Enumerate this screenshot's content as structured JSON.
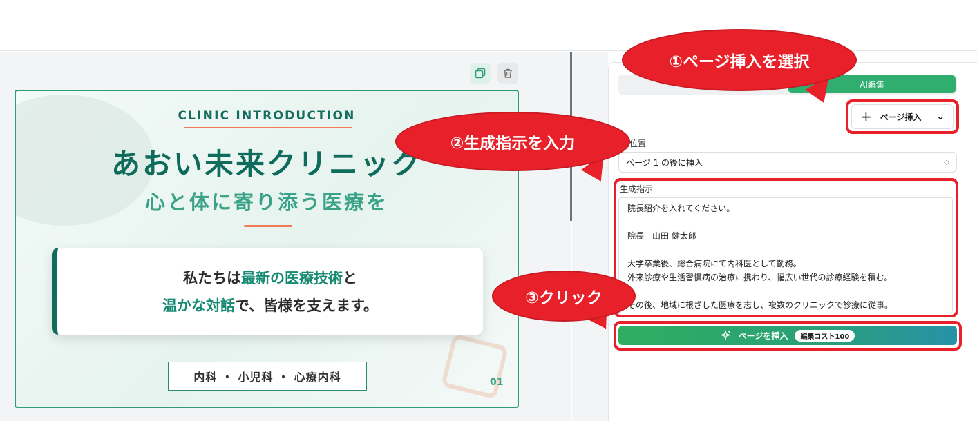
{
  "slide": {
    "kicker": "CLINIC INTRODUCTION",
    "title": "あおい未来クリニック",
    "subtitle": "心と体に寄り添う医療を",
    "message_line1": [
      {
        "text": "私たちは",
        "highlight": false
      },
      {
        "text": "最新の医療技術",
        "highlight": true
      },
      {
        "text": "と",
        "highlight": false
      }
    ],
    "message_line2": [
      {
        "text": "温かな対話",
        "highlight": true
      },
      {
        "text": "で、皆様を支えます。",
        "highlight": false
      }
    ],
    "departments": "内科 ・ 小児科 ・ 心療内科",
    "page_number": "01"
  },
  "panel": {
    "tab_ai_label": "AI編集",
    "insert_button_label": "ページ挿入",
    "position_label": "入位置",
    "position_value": "ページ 1 の後に挿入",
    "instruction_label": "生成指示",
    "instruction_text": "院長紹介を入れてください。\n\n院長　山田 健太郎\n\n大学卒業後、総合病院にて内科医として勤務。\n外来診療や生活習慣病の治療に携わり、幅広い世代の診療経験を積む。\n\nその後、地域に根ざした医療を志し、複数のクリニックで診療に従事。\n患者様一人ひとりに寄り添った、丁寧でわかりやすい診療を大切にしている。",
    "generate_button_label": "ページを挿入",
    "cost_badge": "編集コスト100"
  },
  "callouts": {
    "step1": "①ページ挿入を選択",
    "step2": "②生成指示を入力",
    "step3": "③クリック"
  },
  "colors": {
    "brand_green": "#2fae6f",
    "slide_teal": "#0f6b5c",
    "accent_orange": "#ef7b57",
    "callout_red": "#e8202a"
  }
}
